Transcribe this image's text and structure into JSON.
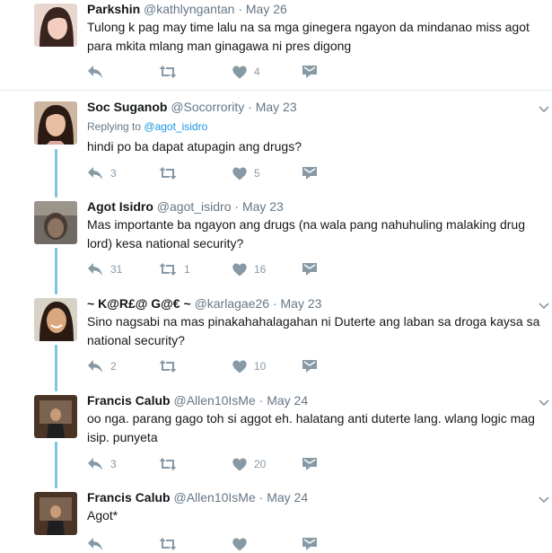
{
  "tweets": [
    {
      "name": "Parkshin",
      "handle": "@kathlyngantan",
      "date": "May 26",
      "reply_to_prefix": "",
      "reply_to_handle": "",
      "text": "Tulong k pag may time lalu na sa mga ginegera ngayon da mindanao miss agot para mkita mlang man ginagawa ni pres digong",
      "replies": "",
      "retweets": "",
      "likes": "4"
    },
    {
      "name": "Soc Suganob",
      "handle": "@Socorrority",
      "date": "May 23",
      "reply_to_prefix": "Replying to",
      "reply_to_handle": "@agot_isidro",
      "text": "hindi po ba dapat atupagin ang drugs?",
      "replies": "3",
      "retweets": "",
      "likes": "5"
    },
    {
      "name": "Agot Isidro",
      "handle": "@agot_isidro",
      "date": "May 23",
      "reply_to_prefix": "",
      "reply_to_handle": "",
      "text": "Mas importante ba ngayon ang drugs (na wala pang nahuhuling malaking drug lord) kesa national security?",
      "replies": "31",
      "retweets": "1",
      "likes": "16"
    },
    {
      "name": "~ K@R£@ G@€ ~",
      "handle": "@karlagae26",
      "date": "May 23",
      "reply_to_prefix": "",
      "reply_to_handle": "",
      "text": "Sino nagsabi na mas pinakahahalagahan ni Duterte ang laban sa droga kaysa sa national security?",
      "replies": "2",
      "retweets": "",
      "likes": "10"
    },
    {
      "name": "Francis Calub",
      "handle": "@Allen10IsMe",
      "date": "May 24",
      "reply_to_prefix": "",
      "reply_to_handle": "",
      "text": "oo nga. parang gago toh si aggot eh. halatang anti duterte lang. wlang logic mag isip. punyeta",
      "replies": "3",
      "retweets": "",
      "likes": "20"
    },
    {
      "name": "Francis Calub",
      "handle": "@Allen10IsMe",
      "date": "May 24",
      "reply_to_prefix": "",
      "reply_to_handle": "",
      "text": "Agot*",
      "replies": "",
      "retweets": "",
      "likes": ""
    }
  ],
  "separator": "·",
  "icons": {
    "reply": "reply-icon",
    "retweet": "retweet-icon",
    "like": "heart-icon",
    "dm": "direct-message-icon",
    "caret": "chevron-down-icon"
  },
  "colors": {
    "action_gray": "#8899a6",
    "link_blue": "#1b95e0",
    "thread_line": "#7ec6dc",
    "separator": "#e6ecf0"
  }
}
